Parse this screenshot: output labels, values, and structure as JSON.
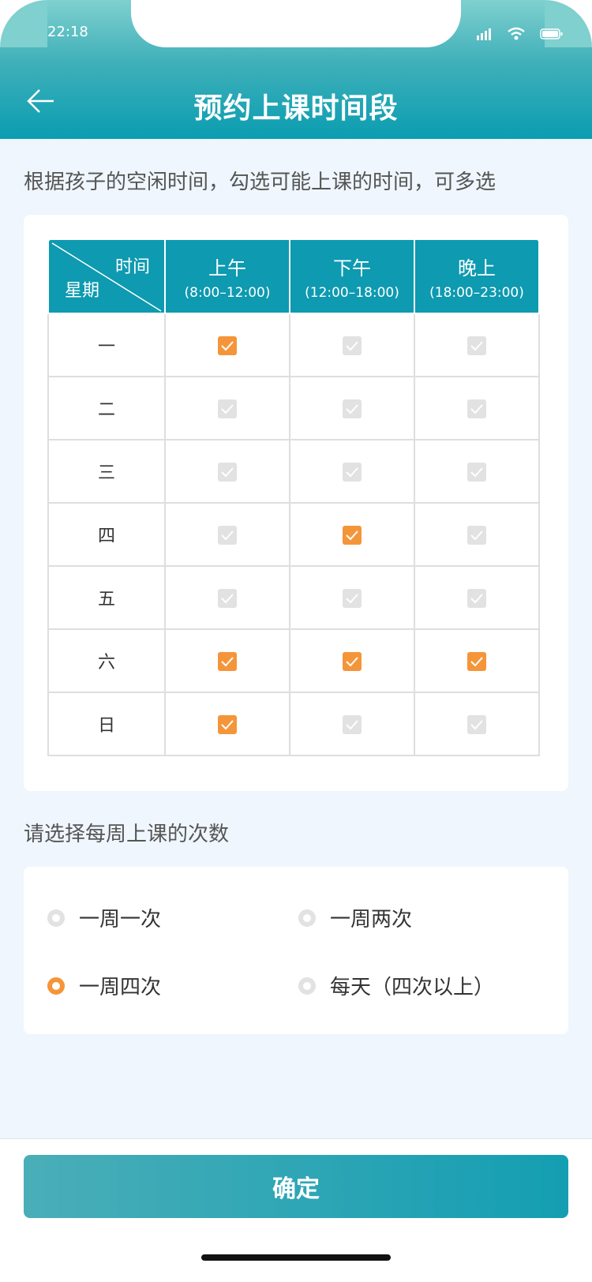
{
  "status_bar": {
    "time": "22:18"
  },
  "header": {
    "title": "预约上课时间段"
  },
  "section1": {
    "hint": "根据孩子的空闲时间，勾选可能上课的时间，可多选"
  },
  "table": {
    "corner_top": "时间",
    "corner_bottom": "星期",
    "columns": [
      {
        "label": "上午",
        "range": "(8:00–12:00)"
      },
      {
        "label": "下午",
        "range": "(12:00–18:00)"
      },
      {
        "label": "晚上",
        "range": "(18:00–23:00)"
      }
    ],
    "rows": [
      {
        "day": "一",
        "checked": [
          true,
          false,
          false
        ]
      },
      {
        "day": "二",
        "checked": [
          false,
          false,
          false
        ]
      },
      {
        "day": "三",
        "checked": [
          false,
          false,
          false
        ]
      },
      {
        "day": "四",
        "checked": [
          false,
          true,
          false
        ]
      },
      {
        "day": "五",
        "checked": [
          false,
          false,
          false
        ]
      },
      {
        "day": "六",
        "checked": [
          true,
          true,
          true
        ]
      },
      {
        "day": "日",
        "checked": [
          true,
          false,
          false
        ]
      }
    ]
  },
  "section2": {
    "hint": "请选择每周上课的次数",
    "options": [
      {
        "label": "一周一次",
        "selected": false
      },
      {
        "label": "一周两次",
        "selected": false
      },
      {
        "label": "一周四次",
        "selected": true
      },
      {
        "label": "每天（四次以上）",
        "selected": false
      }
    ]
  },
  "footer": {
    "confirm_label": "确定"
  },
  "colors": {
    "accent": "#f5953a",
    "brand": "#0e9ab0",
    "unchecked": "#e2e2e2"
  }
}
